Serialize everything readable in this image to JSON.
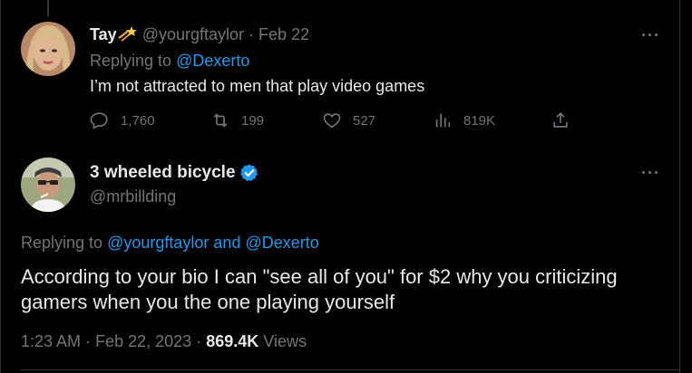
{
  "tweet1": {
    "name": "Tay",
    "handle": "@yourgftaylor",
    "separator": "·",
    "date": "Feb 22",
    "replying_prefix": "Replying to",
    "replying_to": "@Dexerto",
    "text": "I’m not attracted to men that play video games",
    "actions": {
      "replies": "1,760",
      "retweets": "199",
      "likes": "527",
      "views": "819K"
    },
    "icons": {
      "name_emoji": "shooting-star-icon",
      "more": "more-horizontal-icon",
      "reply": "reply-icon",
      "retweet": "retweet-icon",
      "like": "heart-icon",
      "views": "views-icon",
      "share": "share-icon"
    }
  },
  "tweet2": {
    "name": "3 wheeled bicycle",
    "handle": "@mrbillding",
    "replying_prefix": "Replying to",
    "replying_user1": "@yourgftaylor",
    "replying_and": "and",
    "replying_user2": "@Dexerto",
    "text": "According to your bio I can \"see all of you\" for $2 why you criticizing gamers when you the one playing yourself",
    "time": "1:23 AM",
    "separator": "·",
    "date": "Feb 22, 2023",
    "views_count": "869.4K",
    "views_label": "Views",
    "icons": {
      "verified": "verified-badge-icon",
      "more": "more-horizontal-icon"
    }
  },
  "colors": {
    "background": "#000000",
    "text": "#e7e9ea",
    "muted": "#71767b",
    "link": "#1d9bf0",
    "border": "#2f3336"
  }
}
